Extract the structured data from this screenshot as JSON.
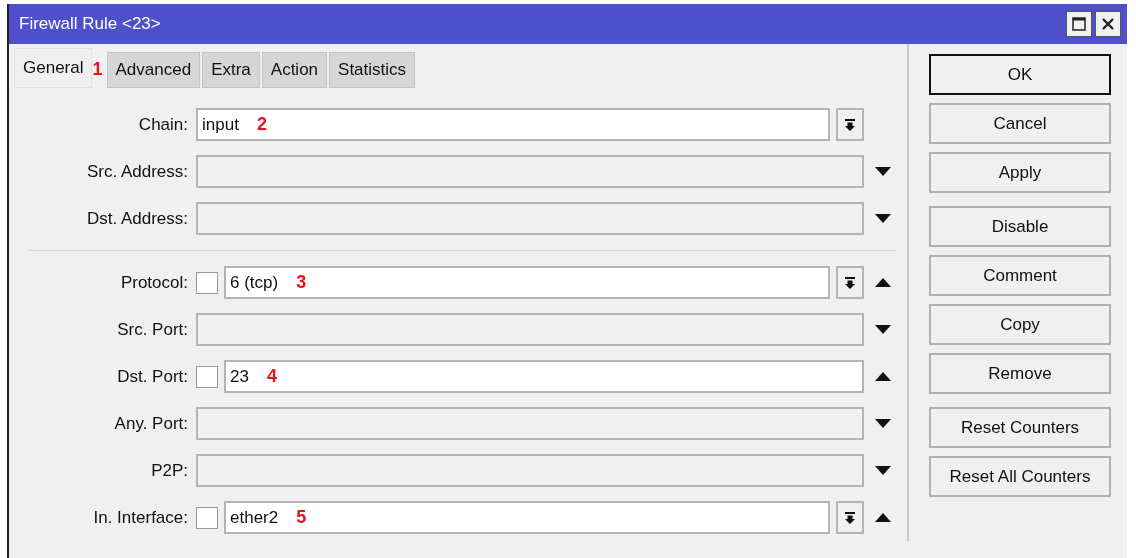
{
  "window": {
    "title": "Firewall Rule <23>"
  },
  "tabs": [
    {
      "label": "General",
      "selected": true,
      "annotation": "1"
    },
    {
      "label": "Advanced",
      "selected": false
    },
    {
      "label": "Extra",
      "selected": false
    },
    {
      "label": "Action",
      "selected": false
    },
    {
      "label": "Statistics",
      "selected": false
    }
  ],
  "sections": [
    [
      {
        "label": "Chain:",
        "value": "input",
        "active": true,
        "menu_button": true,
        "annotation": "2"
      },
      {
        "label": "Src. Address:",
        "active": false,
        "expanded": false
      },
      {
        "label": "Dst. Address:",
        "active": false,
        "expanded": false
      }
    ],
    [
      {
        "label": "Protocol:",
        "checkbox": {
          "checked": false
        },
        "value": "6 (tcp)",
        "active": true,
        "menu_button": true,
        "expanded": true,
        "annotation": "3"
      },
      {
        "label": "Src. Port:",
        "active": false,
        "expanded": false
      },
      {
        "label": "Dst. Port:",
        "checkbox": {
          "checked": false
        },
        "value": "23",
        "active": true,
        "expanded": true,
        "annotation": "4"
      },
      {
        "label": "Any. Port:",
        "active": false,
        "expanded": false
      },
      {
        "label": "P2P:",
        "active": false,
        "expanded": false
      },
      {
        "label": "In. Interface:",
        "checkbox": {
          "checked": false
        },
        "value": "ether2",
        "active": true,
        "menu_button": true,
        "expanded": true,
        "annotation": "5"
      }
    ]
  ],
  "button_groups": [
    [
      {
        "label": "OK",
        "default": true
      },
      {
        "label": "Cancel",
        "default": false
      },
      {
        "label": "Apply",
        "default": false
      }
    ],
    [
      {
        "label": "Disable",
        "default": false
      },
      {
        "label": "Comment",
        "default": false
      },
      {
        "label": "Copy",
        "default": false
      },
      {
        "label": "Remove",
        "default": false
      }
    ],
    [
      {
        "label": "Reset Counters",
        "default": false
      },
      {
        "label": "Reset All Counters",
        "default": false
      }
    ]
  ]
}
